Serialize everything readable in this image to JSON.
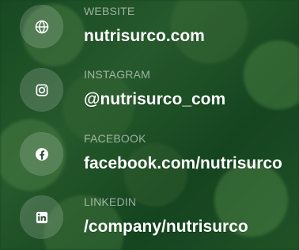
{
  "contacts": [
    {
      "label": "WEBSITE",
      "value": "nutrisurco.com",
      "icon": "globe-icon"
    },
    {
      "label": "INSTAGRAM",
      "value": "@nutrisurco_com",
      "icon": "instagram-icon"
    },
    {
      "label": "FACEBOOK",
      "value": "facebook.com/nutrisurco",
      "icon": "facebook-icon"
    },
    {
      "label": "LINKEDIN",
      "value": "/company/nutrisurco",
      "icon": "linkedin-icon"
    }
  ],
  "colors": {
    "text": "#ffffff",
    "muted_text": "rgba(255,255,255,0.55)",
    "icon_bubble": "rgba(255,255,255,0.16)",
    "background": "#174a24"
  }
}
